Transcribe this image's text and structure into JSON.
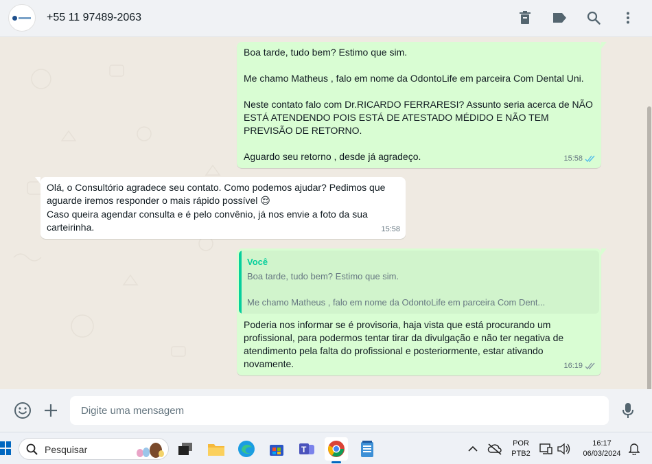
{
  "header": {
    "contact_name": "+55 11 97489-2063",
    "icons": [
      "delete-icon",
      "label-icon",
      "search-icon",
      "menu-icon"
    ]
  },
  "messages": [
    {
      "direction": "out",
      "text": "Boa tarde, tudo bem? Estimo que sim.\n\nMe chamo Matheus , falo em nome da OdontoLife em parceira Com Dental Uni.\n\nNeste contato falo com Dr.RICARDO FERRARESI? Assunto seria acerca de NÃO ESTÁ ATENDENDO POIS ESTÁ DE ATESTADO MÉDIDO E NÃO TEM PREVISÃO DE RETORNO.\n\nAguardo seu retorno , desde já agradeço.",
      "time": "15:58",
      "status": "read"
    },
    {
      "direction": "in",
      "text": "Olá, o Consultório agradece seu contato. Como podemos ajudar? Pedimos que aguarde iremos responder o mais rápido possível",
      "text2": "Caso queira agendar consulta e é pelo convênio, já nos envie a foto da sua carteirinha.",
      "emoji": "😌",
      "time": "15:58"
    },
    {
      "direction": "out",
      "quote_author": "Você",
      "quote_text": "Boa tarde, tudo bem? Estimo que sim.\n\nMe chamo Matheus , falo em nome da OdontoLife em parceira Com Dent...",
      "text": "Poderia nos informar se é provisoria, haja vista que está procurando um profissional, para podermos tentar tirar da divulgação e não ter negativa de atendimento pela falta do profissional e posteriormente, estar ativando novamente.",
      "time": "16:19",
      "status": "delivered"
    }
  ],
  "footer": {
    "placeholder": "Digite uma mensagem",
    "icons": [
      "emoji-icon",
      "attach-plus-icon",
      "microphone-icon"
    ]
  },
  "taskbar": {
    "search_label": "Pesquisar",
    "language_top": "POR",
    "language_bottom": "PTB2",
    "time": "16:17",
    "date": "06/03/2024",
    "accent": "#0067c0"
  },
  "colors": {
    "outgoing_bubble": "#d9fdd3",
    "incoming_bubble": "#ffffff",
    "read_ticks": "#53bdeb",
    "quote_accent": "#06cf9c",
    "chat_bg": "#efeae2"
  }
}
